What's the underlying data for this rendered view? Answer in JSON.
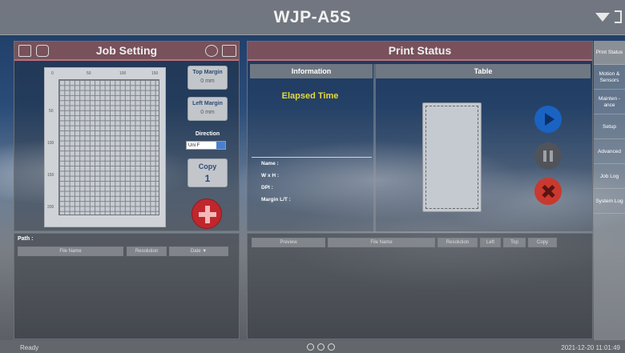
{
  "app": {
    "title": "WJP-A5S"
  },
  "job_setting": {
    "title": "Job Setting",
    "grid_ticks_x": [
      "0",
      "50",
      "100",
      "150"
    ],
    "grid_ticks_y": [
      "50",
      "100",
      "150",
      "200"
    ],
    "top_margin": {
      "label": "Top Margin",
      "value": "0 mm"
    },
    "left_margin": {
      "label": "Left Margin",
      "value": "0 mm"
    },
    "direction": {
      "label": "Direction",
      "selected": "Uni F"
    },
    "copy": {
      "label": "Copy",
      "value": "1"
    },
    "path_label": "Path :",
    "columns": [
      "File Name",
      "Resolution",
      "Date ▼"
    ]
  },
  "print_status": {
    "title": "Print Status",
    "info_header": "Information",
    "table_header": "Table",
    "elapsed_label": "Elapsed Time",
    "info_fields": [
      "Name :",
      "W x H :",
      "DPI :",
      "Margin L/T :"
    ],
    "columns": [
      "Preview",
      "File Name",
      "Resolution",
      "Left",
      "Top",
      "Copy"
    ]
  },
  "nav": [
    {
      "label": "Print Status",
      "active": true
    },
    {
      "label": "Motion & Sensors",
      "active": false
    },
    {
      "label": "Mainten -ance",
      "active": false
    },
    {
      "label": "Setup",
      "active": false
    },
    {
      "label": "Advanced",
      "active": false
    },
    {
      "label": "Job Log",
      "active": false
    },
    {
      "label": "System Log",
      "active": false
    }
  ],
  "footer": {
    "status": "Ready",
    "datetime": "2021-12-20 11:01:49"
  },
  "icons": [
    "doc-settings-icon",
    "image-icon",
    "refresh-icon",
    "folder-icon",
    "dropdown-arrow-icon",
    "exit-icon",
    "play-icon",
    "pause-icon",
    "stop-icon",
    "add-icon"
  ]
}
